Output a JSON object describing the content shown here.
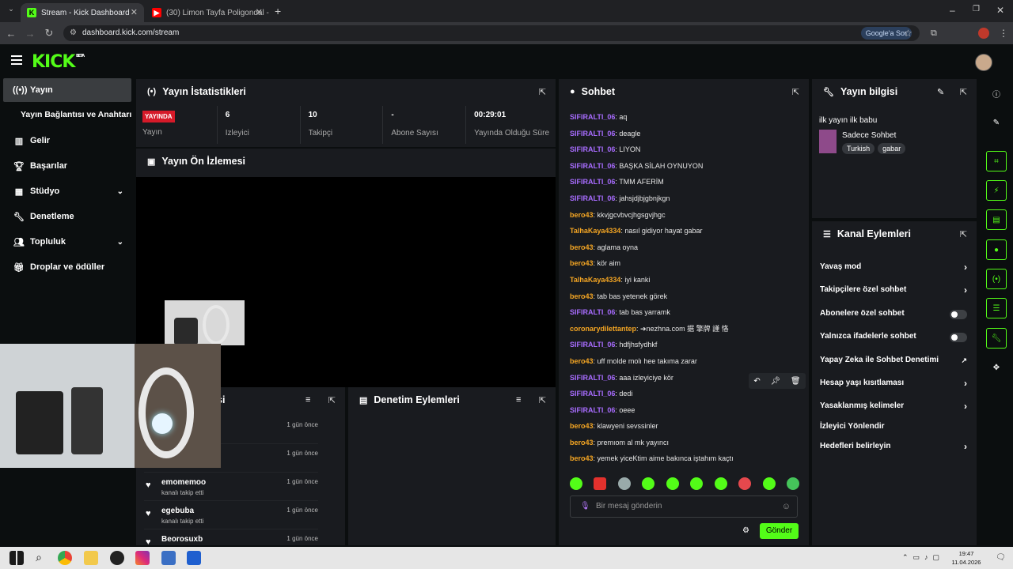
{
  "browser": {
    "tabs": [
      {
        "title": "Stream - Kick Dashboard",
        "active": true
      },
      {
        "title": "(30) Limon Tayfa Poligondal - Y",
        "active": false
      }
    ],
    "url": "dashboard.kick.com/stream",
    "google_pill": "Google'a Sor"
  },
  "header": {
    "logo": "KICK",
    "badge": "BETA"
  },
  "sidebar": {
    "items": [
      {
        "label": "Yayın",
        "icon": "broadcast-icon"
      },
      {
        "label": "Yayın Bağlantısı ve Anahtarı",
        "icon": ""
      },
      {
        "label": "Gelir",
        "icon": "chart-icon"
      },
      {
        "label": "Başarılar",
        "icon": "trophy-icon"
      },
      {
        "label": "Stüdyo",
        "icon": "studio-icon"
      },
      {
        "label": "Denetleme",
        "icon": "wrench-icon"
      },
      {
        "label": "Topluluk",
        "icon": "community-icon"
      },
      {
        "label": "Droplar ve ödüller",
        "icon": "gift-icon"
      }
    ]
  },
  "stats": {
    "title": "Yayın İstatistikleri",
    "live_badge": "YAYINDA",
    "cells": [
      {
        "value": "",
        "label": "Yayın"
      },
      {
        "value": "6",
        "label": "İzleyici"
      },
      {
        "value": "10",
        "label": "Takipçi"
      },
      {
        "value": "-",
        "label": "Abone Sayısı"
      },
      {
        "value": "00:29:01",
        "label": "Yayında Olduğu Süre"
      }
    ]
  },
  "preview": {
    "title": "Yayın Ön İzlemesi"
  },
  "activity": {
    "title_fragment": "şi",
    "items": [
      {
        "name": "",
        "sub": "",
        "time": "1 gün önce"
      },
      {
        "name": "",
        "sub": "",
        "time": "1 gün önce"
      },
      {
        "name": "emomemoo",
        "sub": "kanalı takip etti",
        "time": "1 gün önce"
      },
      {
        "name": "egebuba",
        "sub": "kanalı takip etti",
        "time": "1 gün önce"
      },
      {
        "name": "Beorosuxb",
        "sub": "",
        "time": "1 gün önce"
      }
    ]
  },
  "moderation": {
    "title": "Denetim Eylemleri"
  },
  "chat": {
    "title": "Sohbet",
    "messages": [
      {
        "user": "SIFIRALTI_06",
        "text": "aq",
        "color": "#a86cff"
      },
      {
        "user": "SIFIRALTI_06",
        "text": "deagle",
        "color": "#a86cff"
      },
      {
        "user": "SIFIRALTI_06",
        "text": "LIYON",
        "color": "#a86cff"
      },
      {
        "user": "SIFIRALTI_06",
        "text": "BAŞKA SİLAH OYNUYON",
        "color": "#a86cff"
      },
      {
        "user": "SIFIRALTI_06",
        "text": "TMM AFERİM",
        "color": "#a86cff"
      },
      {
        "user": "SIFIRALTI_06",
        "text": "jahsjdjbjgbnjkgn",
        "color": "#a86cff"
      },
      {
        "user": "bero43",
        "text": "kkvjgcvbvcjhgsgvjhgc",
        "color": "#f5a623"
      },
      {
        "user": "TalhaKaya4334",
        "text": "nasıl gidiyor hayat gabar",
        "color": "#f5a623"
      },
      {
        "user": "bero43",
        "text": "aglama oyna",
        "color": "#f5a623"
      },
      {
        "user": "bero43",
        "text": "kör aim",
        "color": "#f5a623"
      },
      {
        "user": "TalhaKaya4334",
        "text": "iyi kanki",
        "color": "#f5a623"
      },
      {
        "user": "bero43",
        "text": "tab bas yetenek görek",
        "color": "#f5a623"
      },
      {
        "user": "SIFIRALTI_06",
        "text": "tab bas yarramk",
        "color": "#a86cff"
      },
      {
        "user": "coronarydilettantep",
        "text": "➔nezhna.com 据 擎牌 謹 恪",
        "color": "#f5a623"
      },
      {
        "user": "SIFIRALTI_06",
        "text": "hdfjhsfydhkf",
        "color": "#a86cff"
      },
      {
        "user": "bero43",
        "text": "uff molde molı hee takıma zarar",
        "color": "#f5a623"
      },
      {
        "user": "SIFIRALTI_06",
        "text": "aaa izleyiciye kör",
        "color": "#a86cff"
      },
      {
        "user": "SIFIRALTI_06",
        "text": "dedi",
        "color": "#a86cff"
      },
      {
        "user": "SIFIRALTI_06",
        "text": "oeee",
        "color": "#a86cff"
      },
      {
        "user": "bero43",
        "text": "klawyeni sevssinler",
        "color": "#f5a623"
      },
      {
        "user": "bero43",
        "text": "premıom al mk yayıncı",
        "color": "#f5a623"
      },
      {
        "user": "bero43",
        "text": "yemek yiceKtim aime bakınca iştahım kaçtı",
        "color": "#f5a623"
      }
    ],
    "placeholder": "Bir mesaj gönderin",
    "send_label": "Gönder"
  },
  "stream_info": {
    "title": "Yayın bilgisi",
    "stream_title": "ilk yayın ilk babu",
    "category": "Sadece Sohbet",
    "tags": [
      "Turkish",
      "gabar"
    ]
  },
  "channel_actions": {
    "title": "Kanal Eylemleri",
    "items": [
      {
        "label": "Yavaş mod",
        "control": "chevron"
      },
      {
        "label": "Takipçilere özel sohbet",
        "control": "chevron"
      },
      {
        "label": "Abonelere özel sohbet",
        "control": "toggle"
      },
      {
        "label": "Yalnızca ifadelerle sohbet",
        "control": "toggle"
      },
      {
        "label": "Yapay Zeka ile Sohbet Denetimi",
        "control": "external"
      },
      {
        "label": "Hesap yaşı kısıtlaması",
        "control": "chevron"
      },
      {
        "label": "Yasaklanmış kelimeler",
        "control": "chevron"
      },
      {
        "label": "İzleyici Yönlendir",
        "control": "none"
      },
      {
        "label": "Hedefleri belirleyin",
        "control": "chevron"
      }
    ]
  },
  "clock": {
    "time": "19:47",
    "date": "11.04.2026"
  },
  "colors": {
    "accent": "#53fc18",
    "panel": "#191b1f",
    "live": "#d61a29"
  }
}
